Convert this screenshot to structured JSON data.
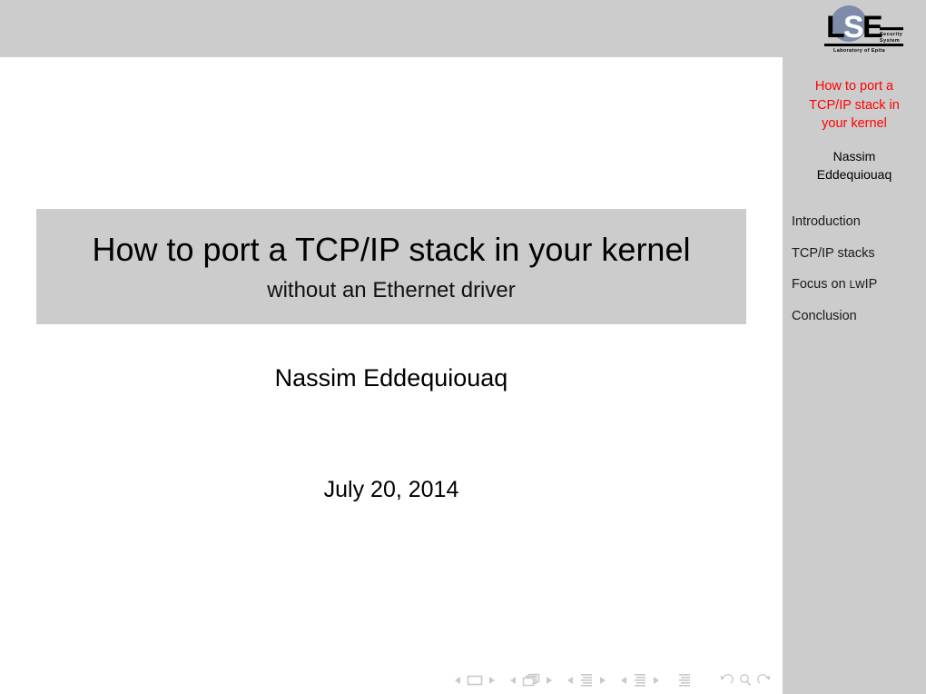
{
  "slide": {
    "background_color": "#ffffff",
    "bar_color": "#cccccc",
    "accent_red": "#ff0000"
  },
  "logo": {
    "name": "lse-logo",
    "letters": "LSE",
    "line1": "Security",
    "line2": "System",
    "footer": "Laboratory of Epita",
    "circle_color": "#7e8bab"
  },
  "sidebar": {
    "title": "How to port a TCP/IP stack in your kernel",
    "title_lines": [
      "How to port a",
      "TCP/IP stack in",
      "your kernel"
    ],
    "author_lines": [
      "Nassim",
      "Eddequiouaq"
    ],
    "items": [
      {
        "label": "Introduction",
        "label_pre": "",
        "smallcap": "",
        "label_post": ""
      },
      {
        "label": "TCP/IP stacks",
        "label_pre": "",
        "smallcap": "",
        "label_post": ""
      },
      {
        "label": "Focus on ʟwIP",
        "label_pre": "Focus on ",
        "smallcap": "L",
        "label_post": "wIP"
      },
      {
        "label": "Conclusion",
        "label_pre": "",
        "smallcap": "",
        "label_post": ""
      }
    ]
  },
  "main": {
    "title": "How to port a TCP/IP stack in your kernel",
    "subtitle": "without an Ethernet driver",
    "author": "Nassim Eddequiouaq",
    "date": "July 20, 2014"
  },
  "navigation_symbols": {
    "items": [
      "prev-slide-arrow",
      "slide-icon",
      "next-slide-arrow",
      "prev-frame-arrow",
      "frame-icon",
      "next-frame-arrow",
      "prev-subsection-arrow",
      "subsection-icon",
      "next-subsection-arrow",
      "prev-section-arrow",
      "section-icon",
      "next-section-arrow",
      "presentation-icon",
      "back-icon",
      "search-icon",
      "forward-icon"
    ]
  }
}
